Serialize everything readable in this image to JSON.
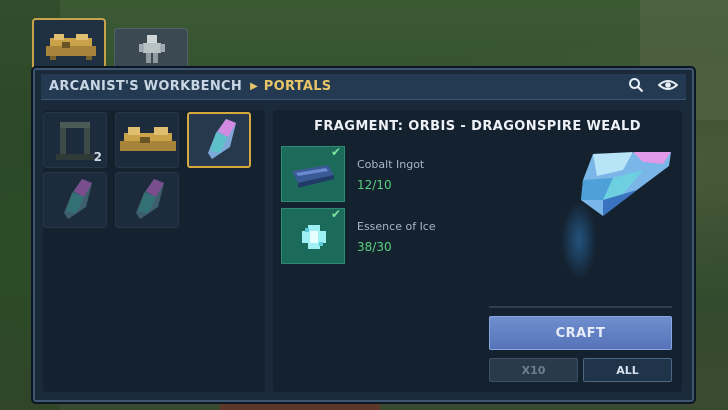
{
  "breadcrumb": {
    "root": "ARCANIST'S WORKBENCH",
    "current": "PORTALS"
  },
  "header_icons": [
    "search-icon",
    "eye-icon"
  ],
  "tabs": [
    {
      "icon": "workbench-icon",
      "active": true
    },
    {
      "icon": "armor-stand-icon",
      "active": false
    }
  ],
  "grid_slots": [
    {
      "icon": "portal-frame-icon",
      "count": "2"
    },
    {
      "icon": "workbench-icon",
      "count": ""
    },
    {
      "icon": "crystal-fragment-icon",
      "count": "",
      "selected": true
    },
    {
      "icon": "crystal-fragment-icon",
      "count": ""
    },
    {
      "icon": "crystal-fragment-icon",
      "count": ""
    }
  ],
  "recipe": {
    "title": "FRAGMENT: ORBIS - DRAGONSPIRE WEALD",
    "ingredients": [
      {
        "name": "Cobalt Ingot",
        "count": "12/10",
        "icon": "cobalt-ingot-icon"
      },
      {
        "name": "Essence of Ice",
        "count": "38/30",
        "icon": "ice-essence-icon"
      }
    ]
  },
  "buttons": {
    "craft": "CRAFT",
    "x10": "X10",
    "all": "ALL"
  },
  "colors": {
    "accent_gold": "#e9c56a",
    "success_green": "#58d27e",
    "craft_blue": "#6080c4"
  }
}
